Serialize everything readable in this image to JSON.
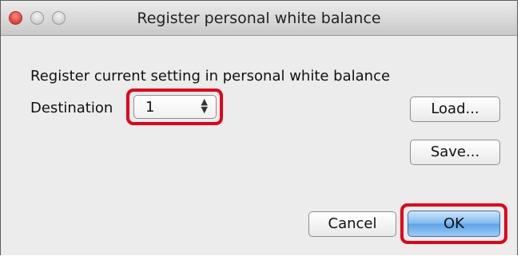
{
  "window": {
    "title": "Register personal white balance",
    "controls": [
      "close-icon",
      "minimize-icon",
      "zoom-icon"
    ]
  },
  "dialog": {
    "prompt": "Register current setting in personal white balance",
    "destination_label": "Destination",
    "destination_value": "1",
    "destination_arrows": "up-down-chevron-icon"
  },
  "buttons": {
    "load": "Load...",
    "save": "Save...",
    "cancel": "Cancel",
    "ok": "OK"
  },
  "colors": {
    "highlight": "#e2001a",
    "default_button": "#5da2e6"
  }
}
